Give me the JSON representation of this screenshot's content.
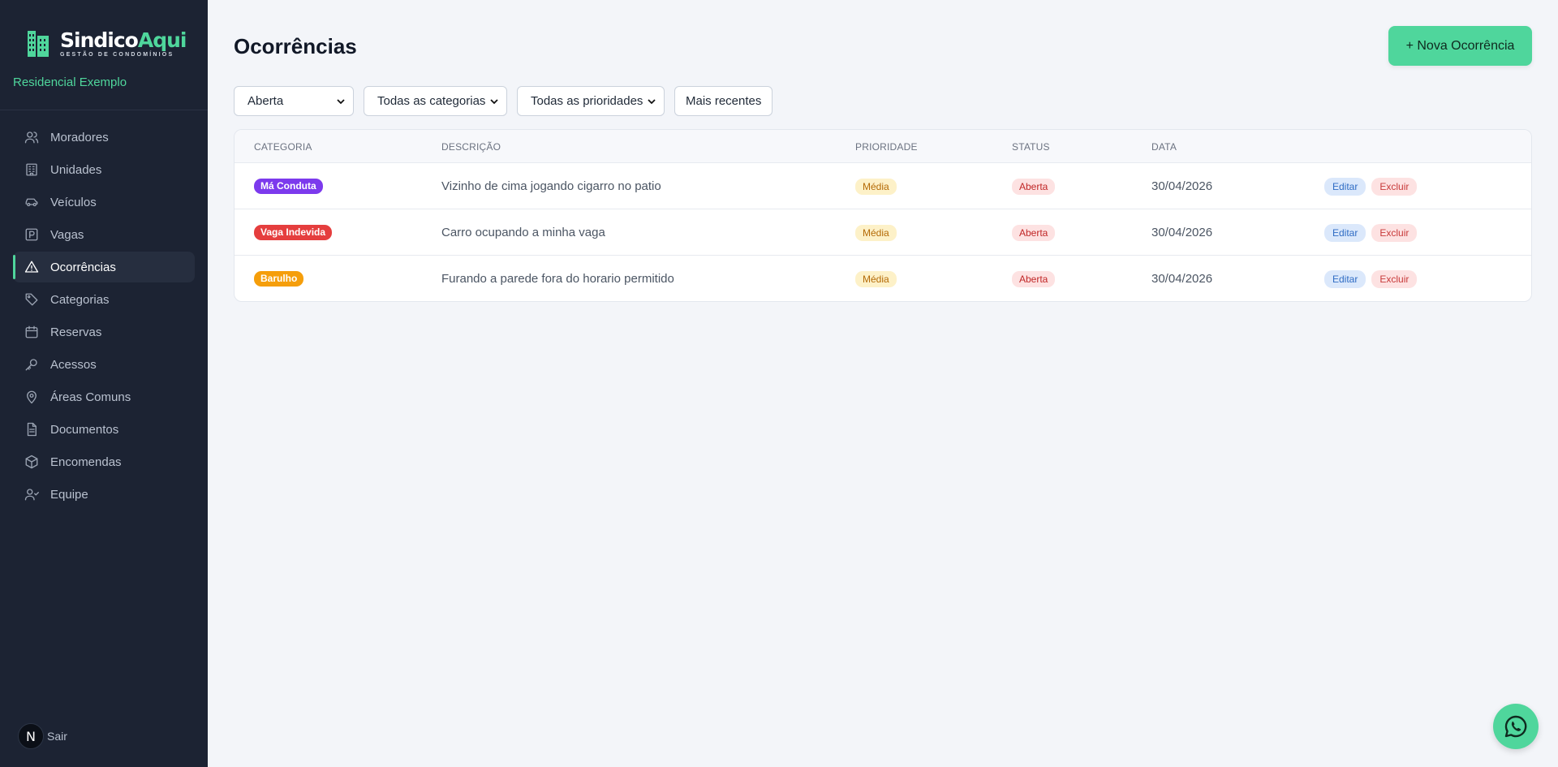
{
  "brand": {
    "name_part1": "Sindico",
    "name_part2": "Aqui",
    "tagline": "GESTÃO DE CONDOMÍNIOS",
    "accent": "#4fd69c"
  },
  "sidebar": {
    "condo_name": "Residencial Exemplo",
    "items": [
      {
        "label": "Moradores",
        "icon": "users-icon"
      },
      {
        "label": "Unidades",
        "icon": "building-icon"
      },
      {
        "label": "Veículos",
        "icon": "car-icon"
      },
      {
        "label": "Vagas",
        "icon": "parking-icon"
      },
      {
        "label": "Ocorrências",
        "icon": "alert-triangle-icon",
        "active": true
      },
      {
        "label": "Categorias",
        "icon": "tag-icon"
      },
      {
        "label": "Reservas",
        "icon": "calendar-icon"
      },
      {
        "label": "Acessos",
        "icon": "key-icon"
      },
      {
        "label": "Áreas Comuns",
        "icon": "map-pin-icon"
      },
      {
        "label": "Documentos",
        "icon": "file-text-icon"
      },
      {
        "label": "Encomendas",
        "icon": "package-icon"
      },
      {
        "label": "Equipe",
        "icon": "team-icon"
      }
    ],
    "user_initial": "N",
    "logout_label": "Sair"
  },
  "main": {
    "title": "Ocorrências",
    "new_button": "+ Nova Ocorrência",
    "filters": {
      "status": "Aberta",
      "category": "Todas as categorias",
      "priority": "Todas as prioridades",
      "sort": "Mais recentes"
    },
    "table": {
      "headers": [
        "CATEGORIA",
        "DESCRIÇÃO",
        "PRIORIDADE",
        "STATUS",
        "DATA"
      ],
      "rows": [
        {
          "category": "Má Conduta",
          "category_color": "#7c3aed",
          "description": "Vizinho de cima jogando cigarro no patio",
          "priority": "Média",
          "status": "Aberta",
          "date": "30/04/2026",
          "edit": "Editar",
          "delete": "Excluir"
        },
        {
          "category": "Vaga Indevida",
          "category_color": "#e53e3e",
          "description": "Carro ocupando a minha vaga",
          "priority": "Média",
          "status": "Aberta",
          "date": "30/04/2026",
          "edit": "Editar",
          "delete": "Excluir"
        },
        {
          "category": "Barulho",
          "category_color": "#f59e0b",
          "description": "Furando a parede fora do horario permitido",
          "priority": "Média",
          "status": "Aberta",
          "date": "30/04/2026",
          "edit": "Editar",
          "delete": "Excluir"
        }
      ]
    }
  },
  "whatsapp": {
    "icon": "whatsapp-icon"
  }
}
